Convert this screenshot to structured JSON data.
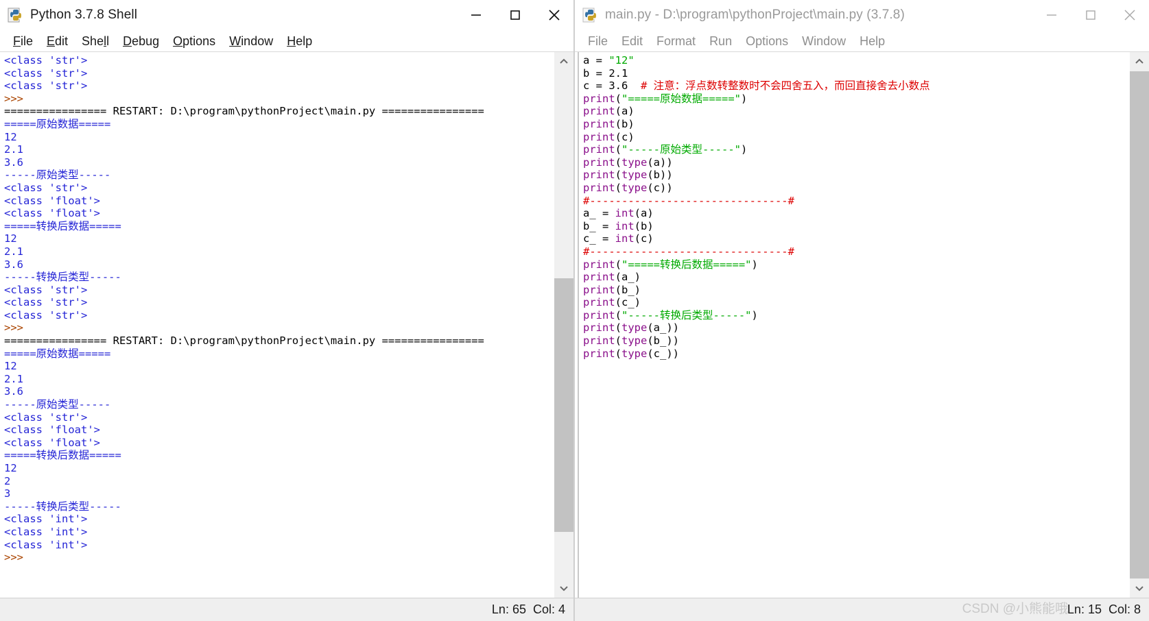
{
  "shell_window": {
    "title": "Python 3.7.8 Shell",
    "icon": "python-logo-icon",
    "menus": [
      {
        "label": "File",
        "accel": "F"
      },
      {
        "label": "Edit",
        "accel": "E"
      },
      {
        "label": "Shell",
        "accel": "l"
      },
      {
        "label": "Debug",
        "accel": "D"
      },
      {
        "label": "Options",
        "accel": "O"
      },
      {
        "label": "Window",
        "accel": "W"
      },
      {
        "label": "Help",
        "accel": "H"
      }
    ],
    "window_controls": {
      "minimize": "minimize-icon",
      "maximize": "maximize-icon",
      "close": "close-icon"
    },
    "status": "Ln: 65  Col: 4",
    "output_lines": [
      [
        {
          "t": "<class 'str'>",
          "c": "c-stdout"
        }
      ],
      [
        {
          "t": "<class 'str'>",
          "c": "c-stdout"
        }
      ],
      [
        {
          "t": "<class 'str'>",
          "c": "c-stdout"
        }
      ],
      [
        {
          "t": ">>> ",
          "c": "c-prompt"
        }
      ],
      [
        {
          "t": "================ RESTART: D:\\program\\pythonProject\\main.py ================",
          "c": "c-restart"
        }
      ],
      [
        {
          "t": "=====原始数据=====",
          "c": "c-stdout"
        }
      ],
      [
        {
          "t": "12",
          "c": "c-stdout"
        }
      ],
      [
        {
          "t": "2.1",
          "c": "c-stdout"
        }
      ],
      [
        {
          "t": "3.6",
          "c": "c-stdout"
        }
      ],
      [
        {
          "t": "-----原始类型-----",
          "c": "c-stdout"
        }
      ],
      [
        {
          "t": "<class 'str'>",
          "c": "c-stdout"
        }
      ],
      [
        {
          "t": "<class 'float'>",
          "c": "c-stdout"
        }
      ],
      [
        {
          "t": "<class 'float'>",
          "c": "c-stdout"
        }
      ],
      [
        {
          "t": "=====转换后数据=====",
          "c": "c-stdout"
        }
      ],
      [
        {
          "t": "12",
          "c": "c-stdout"
        }
      ],
      [
        {
          "t": "2.1",
          "c": "c-stdout"
        }
      ],
      [
        {
          "t": "3.6",
          "c": "c-stdout"
        }
      ],
      [
        {
          "t": "-----转换后类型-----",
          "c": "c-stdout"
        }
      ],
      [
        {
          "t": "<class 'str'>",
          "c": "c-stdout"
        }
      ],
      [
        {
          "t": "<class 'str'>",
          "c": "c-stdout"
        }
      ],
      [
        {
          "t": "<class 'str'>",
          "c": "c-stdout"
        }
      ],
      [
        {
          "t": ">>> ",
          "c": "c-prompt"
        }
      ],
      [
        {
          "t": "================ RESTART: D:\\program\\pythonProject\\main.py ================",
          "c": "c-restart"
        }
      ],
      [
        {
          "t": "=====原始数据=====",
          "c": "c-stdout"
        }
      ],
      [
        {
          "t": "12",
          "c": "c-stdout"
        }
      ],
      [
        {
          "t": "2.1",
          "c": "c-stdout"
        }
      ],
      [
        {
          "t": "3.6",
          "c": "c-stdout"
        }
      ],
      [
        {
          "t": "-----原始类型-----",
          "c": "c-stdout"
        }
      ],
      [
        {
          "t": "<class 'str'>",
          "c": "c-stdout"
        }
      ],
      [
        {
          "t": "<class 'float'>",
          "c": "c-stdout"
        }
      ],
      [
        {
          "t": "<class 'float'>",
          "c": "c-stdout"
        }
      ],
      [
        {
          "t": "=====转换后数据=====",
          "c": "c-stdout"
        }
      ],
      [
        {
          "t": "12",
          "c": "c-stdout"
        }
      ],
      [
        {
          "t": "2",
          "c": "c-stdout"
        }
      ],
      [
        {
          "t": "3",
          "c": "c-stdout"
        }
      ],
      [
        {
          "t": "-----转换后类型-----",
          "c": "c-stdout"
        }
      ],
      [
        {
          "t": "<class 'int'>",
          "c": "c-stdout"
        }
      ],
      [
        {
          "t": "<class 'int'>",
          "c": "c-stdout"
        }
      ],
      [
        {
          "t": "<class 'int'>",
          "c": "c-stdout"
        }
      ],
      [
        {
          "t": ">>> ",
          "c": "c-prompt"
        }
      ]
    ]
  },
  "editor_window": {
    "title": "main.py - D:\\program\\pythonProject\\main.py (3.7.8)",
    "icon": "python-logo-icon",
    "menus": [
      {
        "label": "File"
      },
      {
        "label": "Edit"
      },
      {
        "label": "Format"
      },
      {
        "label": "Run"
      },
      {
        "label": "Options"
      },
      {
        "label": "Window"
      },
      {
        "label": "Help"
      }
    ],
    "window_controls": {
      "minimize": "minimize-icon",
      "maximize": "maximize-icon",
      "close": "close-icon"
    },
    "status": "Ln: 15  Col: 8",
    "watermark": "CSDN @小熊能哦",
    "code_lines": [
      [
        {
          "t": "a = ",
          "c": "c-plain"
        },
        {
          "t": "\"12\"",
          "c": "c-string"
        }
      ],
      [
        {
          "t": "b = 2.1",
          "c": "c-plain"
        }
      ],
      [
        {
          "t": "c = 3.6  ",
          "c": "c-plain"
        },
        {
          "t": "# 注意：浮点数转整数时不会四舍五入，而回直接舍去小数点",
          "c": "c-comment"
        }
      ],
      [
        {
          "t": "print",
          "c": "c-builtin"
        },
        {
          "t": "(",
          "c": "c-plain"
        },
        {
          "t": "\"=====原始数据=====\"",
          "c": "c-string"
        },
        {
          "t": ")",
          "c": "c-plain"
        }
      ],
      [
        {
          "t": "print",
          "c": "c-builtin"
        },
        {
          "t": "(a)",
          "c": "c-plain"
        }
      ],
      [
        {
          "t": "print",
          "c": "c-builtin"
        },
        {
          "t": "(b)",
          "c": "c-plain"
        }
      ],
      [
        {
          "t": "print",
          "c": "c-builtin"
        },
        {
          "t": "(c)",
          "c": "c-plain"
        }
      ],
      [
        {
          "t": "print",
          "c": "c-builtin"
        },
        {
          "t": "(",
          "c": "c-plain"
        },
        {
          "t": "\"-----原始类型-----\"",
          "c": "c-string"
        },
        {
          "t": ")",
          "c": "c-plain"
        }
      ],
      [
        {
          "t": "print",
          "c": "c-builtin"
        },
        {
          "t": "(",
          "c": "c-plain"
        },
        {
          "t": "type",
          "c": "c-builtin"
        },
        {
          "t": "(a))",
          "c": "c-plain"
        }
      ],
      [
        {
          "t": "print",
          "c": "c-builtin"
        },
        {
          "t": "(",
          "c": "c-plain"
        },
        {
          "t": "type",
          "c": "c-builtin"
        },
        {
          "t": "(b))",
          "c": "c-plain"
        }
      ],
      [
        {
          "t": "print",
          "c": "c-builtin"
        },
        {
          "t": "(",
          "c": "c-plain"
        },
        {
          "t": "type",
          "c": "c-builtin"
        },
        {
          "t": "(c))",
          "c": "c-plain"
        }
      ],
      [
        {
          "t": "#-------------------------------#",
          "c": "c-comment"
        }
      ],
      [
        {
          "t": "a_ = ",
          "c": "c-plain"
        },
        {
          "t": "int",
          "c": "c-builtin"
        },
        {
          "t": "(a)",
          "c": "c-plain"
        }
      ],
      [
        {
          "t": "b_ = ",
          "c": "c-plain"
        },
        {
          "t": "int",
          "c": "c-builtin"
        },
        {
          "t": "(b)",
          "c": "c-plain"
        }
      ],
      [
        {
          "t": "c_ = ",
          "c": "c-plain"
        },
        {
          "t": "int",
          "c": "c-builtin"
        },
        {
          "t": "(c)",
          "c": "c-plain"
        }
      ],
      [
        {
          "t": "#-------------------------------#",
          "c": "c-comment"
        }
      ],
      [
        {
          "t": "print",
          "c": "c-builtin"
        },
        {
          "t": "(",
          "c": "c-plain"
        },
        {
          "t": "\"=====转换后数据=====\"",
          "c": "c-string"
        },
        {
          "t": ")",
          "c": "c-plain"
        }
      ],
      [
        {
          "t": "print",
          "c": "c-builtin"
        },
        {
          "t": "(a_)",
          "c": "c-plain"
        }
      ],
      [
        {
          "t": "print",
          "c": "c-builtin"
        },
        {
          "t": "(b_)",
          "c": "c-plain"
        }
      ],
      [
        {
          "t": "print",
          "c": "c-builtin"
        },
        {
          "t": "(c_)",
          "c": "c-plain"
        }
      ],
      [
        {
          "t": "print",
          "c": "c-builtin"
        },
        {
          "t": "(",
          "c": "c-plain"
        },
        {
          "t": "\"-----转换后类型-----\"",
          "c": "c-string"
        },
        {
          "t": ")",
          "c": "c-plain"
        }
      ],
      [
        {
          "t": "print",
          "c": "c-builtin"
        },
        {
          "t": "(",
          "c": "c-plain"
        },
        {
          "t": "type",
          "c": "c-builtin"
        },
        {
          "t": "(a_))",
          "c": "c-plain"
        }
      ],
      [
        {
          "t": "print",
          "c": "c-builtin"
        },
        {
          "t": "(",
          "c": "c-plain"
        },
        {
          "t": "type",
          "c": "c-builtin"
        },
        {
          "t": "(b_))",
          "c": "c-plain"
        }
      ],
      [
        {
          "t": "print",
          "c": "c-builtin"
        },
        {
          "t": "(",
          "c": "c-plain"
        },
        {
          "t": "type",
          "c": "c-builtin"
        },
        {
          "t": "(c_))",
          "c": "c-plain"
        }
      ]
    ]
  },
  "colors": {
    "stdout_blue": "#2525d6",
    "prompt_brown": "#aa4400",
    "string_green": "#00aa00",
    "builtin_purple": "#8a0f8a",
    "comment_red": "#dd0000",
    "scrollbar_thumb": "#c2c2c2",
    "statusbar_bg": "#efefef"
  }
}
